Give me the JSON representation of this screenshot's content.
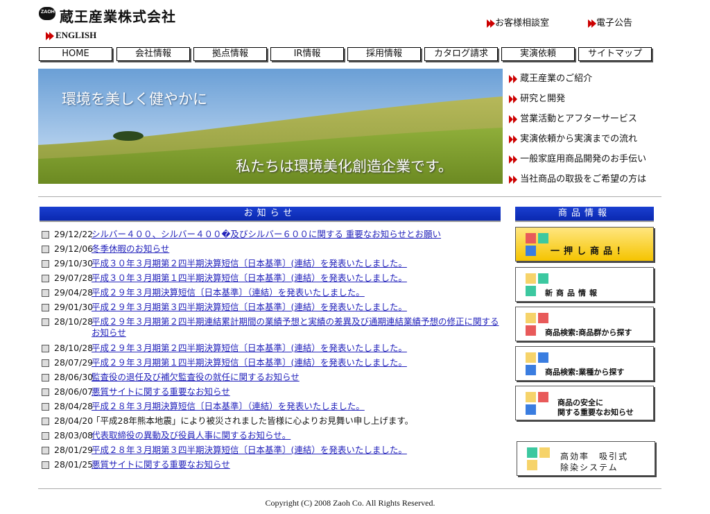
{
  "header": {
    "logo_text": "ZAOH",
    "company": "蔵王産業株式会社",
    "english": "ENGLISH",
    "links": [
      "お客様相談室",
      "電子公告"
    ]
  },
  "nav": [
    "HOME",
    "会社情報",
    "拠点情報",
    "IR情報",
    "採用情報",
    "カタログ請求",
    "実演依頼",
    "サイトマップ"
  ],
  "hero": {
    "line1": "環境を美しく健やかに",
    "line2": "私たちは環境美化創造企業です。"
  },
  "side_links": [
    "蔵王産業のご紹介",
    "研究と開発",
    "営業活動とアフターサービス",
    "実演依頼から実演までの流れ",
    "一般家庭用商品開発のお手伝い",
    "当社商品の取扱をご希望の方は"
  ],
  "news": {
    "title": "お知らせ",
    "items": [
      {
        "date": "29/12/22",
        "text": "シルバー４００、シルバー４００�及びシルバー６００に関する 重要なお知らせとお願い",
        "link": true
      },
      {
        "date": "29/12/06",
        "text": "冬季休暇のお知らせ",
        "link": true
      },
      {
        "date": "29/10/30",
        "text": "平成３０年３月期第２四半期決算短信〔日本基準〕(連結）を発表いたしました。",
        "link": true
      },
      {
        "date": "29/07/28",
        "text": "平成３０年３月期第１四半期決算短信〔日本基準〕(連結）を発表いたしました。",
        "link": true
      },
      {
        "date": "29/04/28",
        "text": "平成２９年３月期決算短信〔日本基準〕（連結）を発表いたしました。",
        "link": true
      },
      {
        "date": "29/01/30",
        "text": "平成２９年３月期第３四半期決算短信〔日本基準〕(連結）を発表いたしました。",
        "link": true
      },
      {
        "date": "28/10/28",
        "text": "平成２９年３月期第２四半期連結累計期間の業績予想と実績の差異及び通期連結業績予想の修正に関するお知らせ",
        "link": true
      },
      {
        "date": "28/10/28",
        "text": "平成２９年３月期第２四半期決算短信〔日本基準〕(連結）を発表いたしました。",
        "link": true
      },
      {
        "date": "28/07/29",
        "text": "平成２９年３月期第１四半期決算短信〔日本基準〕(連結）を発表いたしました。",
        "link": true
      },
      {
        "date": "28/06/30",
        "text": "監査役の退任及び補欠監査役の就任に関するお知らせ",
        "link": true
      },
      {
        "date": "28/06/07",
        "text": "悪質サイトに関する重要なお知らせ",
        "link": true
      },
      {
        "date": "28/04/28",
        "text": "平成２８年３月期決算短信〔日本基準〕（連結）を発表いたしました。",
        "link": true
      },
      {
        "date": "28/04/20",
        "text": "「平成28年熊本地震」により被災されました皆様に心よりお見舞い申し上げます。",
        "link": false
      },
      {
        "date": "28/03/08",
        "text": "代表取締役の異動及び役員人事に関するお知らせ。",
        "link": true
      },
      {
        "date": "28/01/29",
        "text": "平成２８年３月期第３四半期決算短信〔日本基準〕(連結）を発表いたしました。",
        "link": true
      },
      {
        "date": "28/01/25",
        "text": "悪質サイトに関する重要なお知らせ",
        "link": true
      }
    ]
  },
  "products": {
    "title": "商品情報",
    "items": [
      {
        "label": "一押し商品！"
      },
      {
        "label": "新商品情報"
      },
      {
        "label": "商品検索:商品群から探す"
      },
      {
        "label": "商品検索:業種から探す"
      },
      {
        "label": "商品の安全に\n関する重要なお知らせ"
      },
      {
        "label": "高効率　吸引式\n除染システム"
      }
    ]
  },
  "footer": "Copyright (C) 2008 Zaoh Co. All Rights Reserved."
}
